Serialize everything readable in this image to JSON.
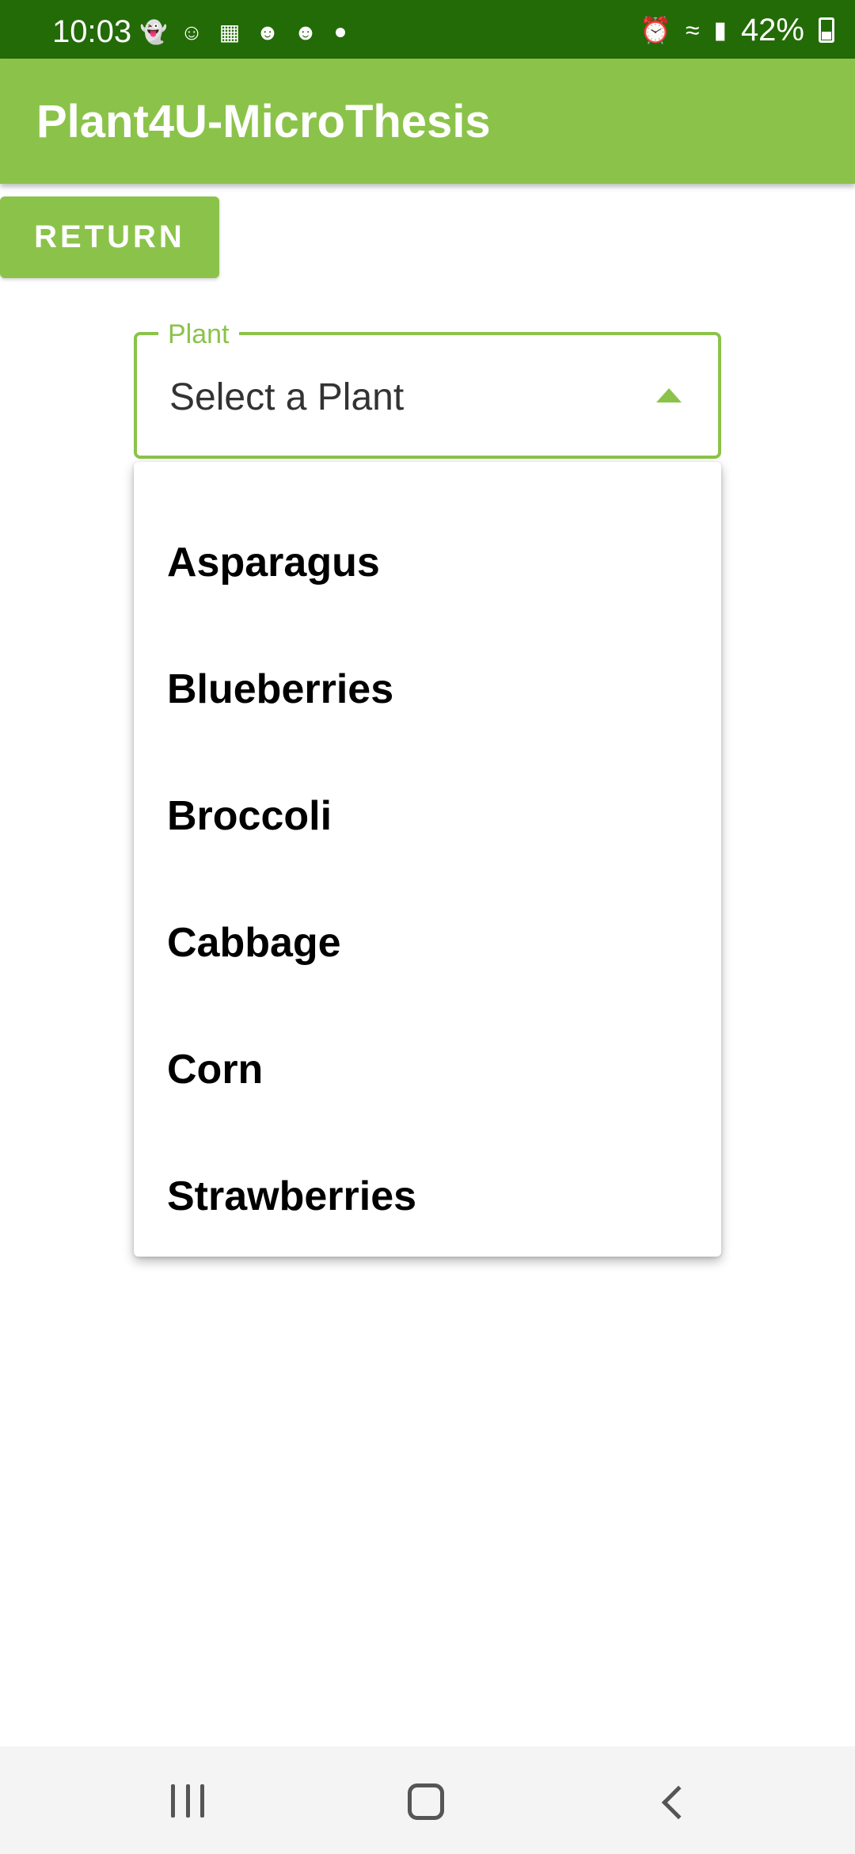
{
  "status_bar": {
    "time": "10:03",
    "battery": "42%",
    "left_icons": [
      "snapchat-icon",
      "reddit-icon",
      "webtoon-icon",
      "reddit-icon",
      "reddit-icon",
      "dot-icon"
    ],
    "right_icons": [
      "alarm-icon",
      "wifi-icon",
      "signal-icon",
      "battery-icon"
    ]
  },
  "app_bar": {
    "title": "Plant4U-MicroThesis",
    "color": "#8bc34a"
  },
  "return_button": {
    "label": "RETURN"
  },
  "plant_select": {
    "label": "Plant",
    "value": "Select a Plant",
    "options": [
      "Asparagus",
      "Blueberries",
      "Broccoli",
      "Cabbage",
      "Corn",
      "Strawberries"
    ]
  },
  "nav_bar": {
    "buttons": [
      "recents-icon",
      "home-icon",
      "back-icon"
    ]
  }
}
